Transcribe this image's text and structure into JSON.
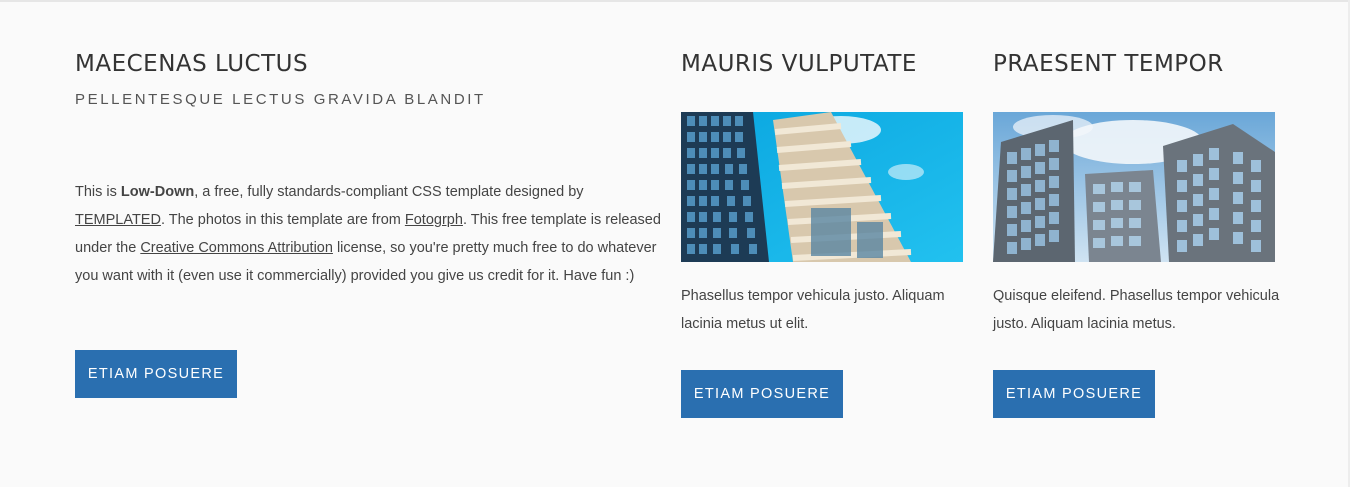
{
  "main": {
    "title": "MAECENAS LUCTUS",
    "subtitle": "PELLENTESQUE LECTUS GRAVIDA BLANDIT",
    "intro_before": "This is ",
    "intro_bold": "Low-Down",
    "intro_mid1": ", a free, fully standards-compliant CSS template designed by ",
    "link_templated": "TEMPLATED",
    "intro_mid2": ". The photos in this template are from ",
    "link_fotogrph": "Fotogrph",
    "intro_mid3": ". This free template is released under the ",
    "link_cc": "Creative Commons Attribution",
    "intro_after": " license, so you're pretty much free to do whatever you want with it (even use it commercially) provided you give us credit for it. Have fun :)",
    "button_label": "ETIAM POSUERE"
  },
  "column_b": {
    "title": "MAURIS VULPUTATE",
    "text": "Phasellus tempor vehicula justo. Aliquam lacinia metus ut elit.",
    "button_label": "ETIAM POSUERE"
  },
  "column_c": {
    "title": "PRAESENT TEMPOR",
    "text": "Quisque eleifend. Phasellus tempor vehicula justo. Aliquam lacinia metus.",
    "button_label": "ETIAM POSUERE"
  },
  "colors": {
    "accent": "#2a6fb0",
    "sky": "#1ab5e6",
    "background": "#fafafa"
  }
}
